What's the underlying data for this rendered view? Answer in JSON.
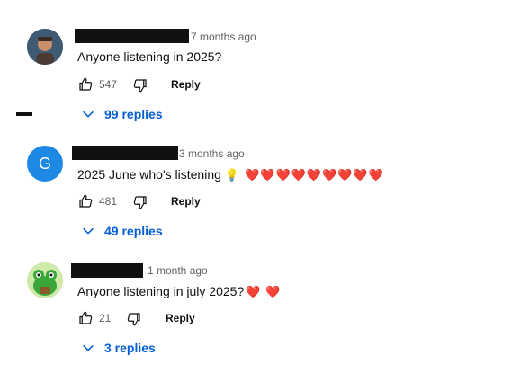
{
  "comments": [
    {
      "time": "7 months ago",
      "text": "Anyone listening in 2025?",
      "likes": "547",
      "reply_label": "Reply",
      "replies_label": "99 replies"
    },
    {
      "avatar_letter": "G",
      "time": "3 months ago",
      "text": "2025 June who's listening",
      "bulb": "💡",
      "hearts": "❤️❤️❤️❤️❤️❤️❤️❤️❤️",
      "likes": "481",
      "reply_label": "Reply",
      "replies_label": "49 replies"
    },
    {
      "time": "1 month ago",
      "text": "Anyone listening in july 2025?",
      "hearts": "❤️ ❤️",
      "likes": "21",
      "reply_label": "Reply",
      "replies_label": "3 replies"
    }
  ],
  "colors": {
    "link": "#065fd4",
    "secondary": "#606060",
    "avatar_g": "#1e88e5"
  }
}
